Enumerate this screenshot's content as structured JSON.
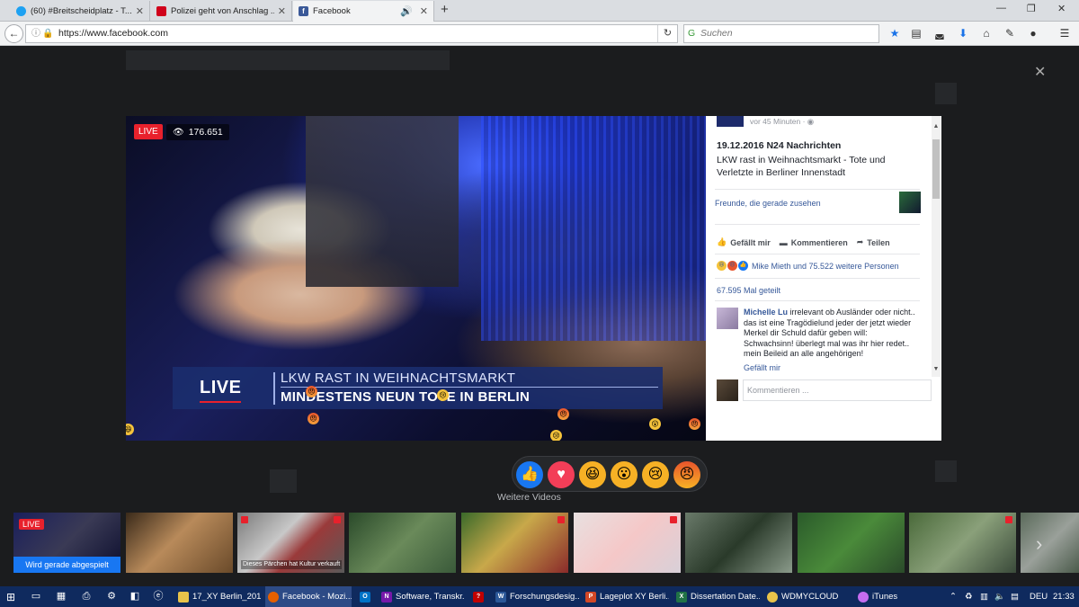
{
  "browser": {
    "tabs": [
      {
        "label": "(60) #Breitscheidplatz - T...",
        "icon": "twitter-icon",
        "color": "#1da1f2"
      },
      {
        "label": "Polizei geht von Anschlag ...",
        "icon": "news-icon",
        "color": "#d0021b"
      },
      {
        "label": "Facebook",
        "icon": "facebook-icon",
        "color": "#3b5998",
        "active": true
      }
    ],
    "new_tab": "+",
    "url": "https://www.facebook.com",
    "search_placeholder": "Suchen"
  },
  "video": {
    "live_badge": "LIVE",
    "viewers": "176.651",
    "lower_third": {
      "tag": "LIVE",
      "line1": "LKW RAST IN WEIHNACHTSMARKT",
      "line2": "MINDESTENS NEUN TOTE IN BERLIN"
    }
  },
  "post": {
    "meta": "vor 45 Minuten · ",
    "title": "19.12.2016 N24 Nachrichten",
    "description": "LKW rast in Weihnachtsmarkt - Tote und Verletzte in Berliner Innenstadt",
    "friends_watching": "Freunde, die gerade zusehen",
    "actions": {
      "like": "Gefällt mir",
      "comment": "Kommentieren",
      "share": "Teilen"
    },
    "reactions_summary": "Mike Mieth und 75.522 weitere Personen",
    "shares": "67.595 Mal geteilt",
    "comment": {
      "author": "Michelle Lu",
      "text": "irrelevant ob Ausländer oder nicht.. das ist eine Tragödielund jeder der jetzt wieder Merkel dir Schuld dafür geben will: Schwachsinn! überlegt mal was ihr hier redet.. mein Beileid an alle angehörigen!",
      "like": "Gefällt mir"
    },
    "comment_placeholder": "Kommentieren ..."
  },
  "more_videos": {
    "label": "Weitere Videos",
    "first_live": "LIVE",
    "first_status": "Wird gerade abgespielt",
    "caption_3": "Dieses Pärchen hat Kultur verkauft"
  },
  "taskbar": {
    "items": [
      {
        "label": "17_XY Berlin_201...",
        "color": "#e8c34a",
        "ic": ""
      },
      {
        "label": "Facebook - Mozi...",
        "color": "#e66000",
        "ic": "",
        "active": true
      },
      {
        "label": "",
        "color": "#0072c6",
        "ic": "O"
      },
      {
        "label": "Software, Transkr...",
        "color": "#7719aa",
        "ic": "N"
      },
      {
        "label": "",
        "color": "#c00000",
        "ic": "?"
      },
      {
        "label": "Forschungsdesig...",
        "color": "#2b5797",
        "ic": "W"
      },
      {
        "label": "Lageplot XY Berli...",
        "color": "#d24726",
        "ic": "P"
      },
      {
        "label": "Dissertation Date...",
        "color": "#217346",
        "ic": "X"
      },
      {
        "label": "WDMYCLOUD",
        "color": "#e8c34a",
        "ic": ""
      },
      {
        "label": "iTunes",
        "color": "#c56cf0",
        "ic": ""
      }
    ],
    "lang": "DEU",
    "time": "21:33"
  }
}
